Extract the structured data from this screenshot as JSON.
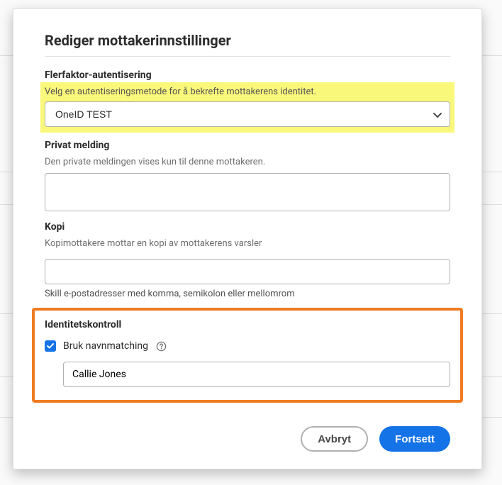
{
  "modal": {
    "title": "Rediger mottakerinnstillinger",
    "mfa": {
      "label": "Flerfaktor-autentisering",
      "hint": "Velg en autentiseringsmetode for å bekrefte mottakerens identitet.",
      "selected": "OneID TEST"
    },
    "privateMessage": {
      "label": "Privat melding",
      "hint": "Den private meldingen vises kun til denne mottakeren.",
      "value": ""
    },
    "copy": {
      "label": "Kopi",
      "hint": "Kopimottakere mottar en kopi av mottakerens varsler",
      "value": "",
      "belowHint": "Skill e-postadresser med komma, semikolon eller mellomrom"
    },
    "identity": {
      "label": "Identitetskontroll",
      "checkboxLabel": "Bruk navnmatching",
      "checked": true,
      "name": "Callie Jones"
    },
    "buttons": {
      "cancel": "Avbryt",
      "continue": "Fortsett"
    }
  }
}
